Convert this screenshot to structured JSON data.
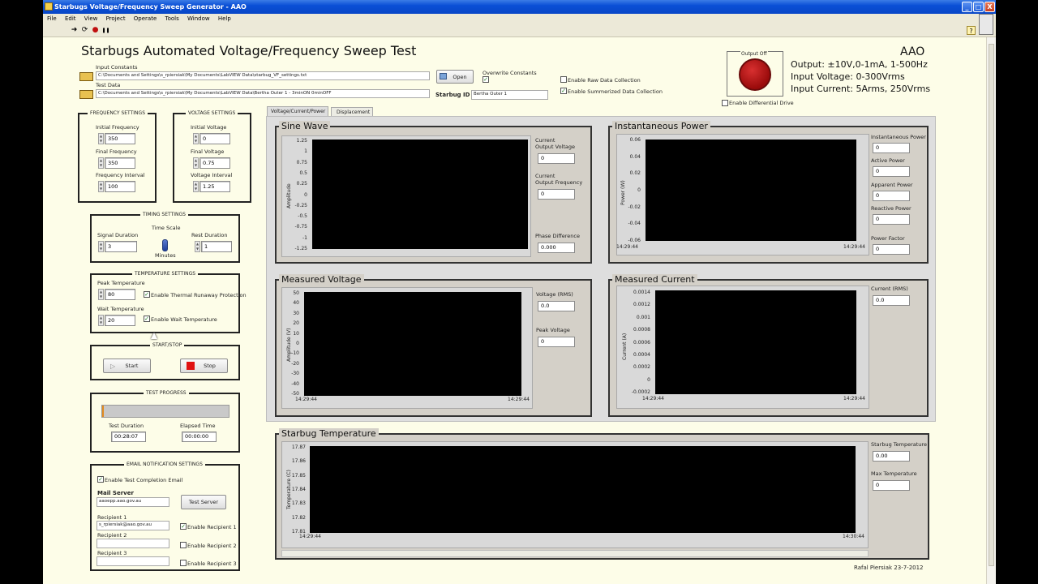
{
  "window": {
    "title": "Starbugs Voltage/Frequency Sweep Generator - AAO",
    "minimize": "_",
    "maximize": "□",
    "close": "X"
  },
  "menu": [
    "File",
    "Edit",
    "View",
    "Project",
    "Operate",
    "Tools",
    "Window",
    "Help"
  ],
  "toolbar": {
    "run": "➜",
    "run_continuous": "⟳",
    "abort": "●",
    "pause": "❚❚",
    "help": "?"
  },
  "header": {
    "title": "Starbugs Automated Voltage/Frequency Sweep Test",
    "org": "AAO",
    "spec1": "Output: ±10V,0-1mA, 1-500Hz",
    "spec2": "Input Voltage: 0-300Vrms",
    "spec3": "Input Current: 5Arms, 250Vrms"
  },
  "files": {
    "input_constants_label": "Input Constants",
    "input_constants_path": "C:\\Documents and Settings\\s_rpiersiak\\My Documents\\LabVIEW Data\\starbug_VF_settings.txt",
    "test_data_label": "Test Data",
    "test_data_path": "C:\\Documents and Settings\\s_rpiersiak\\My Documents\\LabVIEW Data\\Bertha Outer 1 - 3minON 0minOFF",
    "open_label": "Open",
    "overwrite_label": "Overwrite Constants",
    "starbug_id_label": "Starbug ID",
    "starbug_id_value": "Bertha Outer 1",
    "raw_data_label": "Enable Raw Data Collection",
    "summ_data_label": "Enable Summerized Data Collection"
  },
  "output": {
    "label": "Output Off",
    "diff_drive_label": "Enable Differential Drive"
  },
  "frequency": {
    "title": "FREQUENCY SETTINGS",
    "initial_label": "Initial Frequency",
    "initial": "350",
    "final_label": "Final Frequency",
    "final": "350",
    "interval_label": "Frequency Interval",
    "interval": "100"
  },
  "voltage": {
    "title": "VOLTAGE SETTINGS",
    "initial_label": "Initial Voltage",
    "initial": "0",
    "final_label": "Final Voltage",
    "final": "0.75",
    "interval_label": "Voltage Interval",
    "interval": "1.25"
  },
  "timing": {
    "title": "TIMING SETTINGS",
    "signal_label": "Signal Duration",
    "signal": "3",
    "scale_label": "Time Scale",
    "scale_value": "Minutes",
    "rest_label": "Rest Duration",
    "rest": "1"
  },
  "temperature": {
    "title": "TEMPERATURE SETTINGS",
    "peak_label": "Peak Temperature",
    "peak": "80",
    "runaway_label": "Enable Thermal Runaway Protection",
    "wait_label": "Wait Temperature",
    "wait": "20",
    "enable_wait_label": "Enable Wait Temperature"
  },
  "startstop": {
    "title": "START/STOP",
    "start": "Start",
    "stop": "Stop"
  },
  "progress": {
    "title": "TEST PROGRESS",
    "fraction": 0.01,
    "duration_label": "Test Duration",
    "duration": "00:28:07",
    "elapsed_label": "Elapsed Time",
    "elapsed": "00:00:00"
  },
  "email": {
    "title": "EMAIL NOTIFICATION SETTINGS",
    "enable_label": "Enable Test Completion Email",
    "server_label": "Mail Server",
    "server": "aaoepp.aao.gov.au",
    "test_server": "Test Server",
    "r1_label": "Recipient 1",
    "r1": "s_rpiersiak@aao.gov.au",
    "r1_enable": "Enable Recipient 1",
    "r2_label": "Recipient 2",
    "r2": "",
    "r2_enable": "Enable Recipient 2",
    "r3_label": "Recipient 3",
    "r3": "",
    "r3_enable": "Enable Recipient 3"
  },
  "tabs": [
    "Voltage/Current/Power",
    "Displacement"
  ],
  "sine": {
    "title": "Sine Wave",
    "ylabel": "Amplitude",
    "yticks": [
      "1.25",
      "1",
      "0.75",
      "0.5",
      "0.25",
      "0",
      "-0.25",
      "-0.5",
      "-0.75",
      "-1",
      "-1.25"
    ],
    "ind1_label1": "Current",
    "ind1_label2": "Output Voltage",
    "ind1": "0",
    "ind2_label1": "Current",
    "ind2_label2": "Output Frequency",
    "ind2": "0",
    "ind3_label": "Phase Difference",
    "ind3": "0.000"
  },
  "power": {
    "title": "Instantaneous Power",
    "ylabel": "Power (W)",
    "yticks": [
      "0.06",
      "0.04",
      "0.02",
      "0",
      "-0.02",
      "-0.04",
      "-0.06"
    ],
    "x0": "14:29:44",
    "x1": "14:29:44",
    "inst_label": "Instantaneous Power",
    "inst": "0",
    "active_label": "Active Power",
    "active": "0",
    "apparent_label": "Apparent Power",
    "apparent": "0",
    "reactive_label": "Reactive Power",
    "reactive": "0",
    "pf_label": "Power Factor",
    "pf": "0"
  },
  "mvolt": {
    "title": "Measured Voltage",
    "ylabel": "Amplitude (V)",
    "yticks": [
      "50",
      "40",
      "30",
      "20",
      "10",
      "0",
      "-10",
      "-20",
      "-30",
      "-40",
      "-50"
    ],
    "x0": "14:29:44",
    "x1": "14:29:44",
    "rms_label": "Voltage (RMS)",
    "rms": "0.0",
    "peak_label": "Peak Voltage",
    "peak": "0"
  },
  "mcurr": {
    "title": "Measured Current",
    "ylabel": "Current (A)",
    "yticks": [
      "0.0014",
      "0.0012",
      "0.001",
      "0.0008",
      "0.0006",
      "0.0004",
      "0.0002",
      "0",
      "-0.0002"
    ],
    "x0": "14:29:44",
    "x1": "14:29:44",
    "rms_label": "Current (RMS)",
    "rms": "0.0"
  },
  "temp": {
    "title": "Starbug Temperature",
    "ylabel": "Temperature (C)",
    "yticks": [
      "17.87",
      "17.86",
      "17.85",
      "17.84",
      "17.83",
      "17.82",
      "17.81"
    ],
    "x0": "14:29:44",
    "x1": "14:30:44",
    "st_label": "Starbug Temperature",
    "st": "0.00",
    "max_label": "Max Temperature",
    "max": "0"
  },
  "footer": "Rafal Piersiak 23-7-2012",
  "colors": {
    "titlebar": "#0a4fd6",
    "panel_bg": "#fdfde8",
    "led": "#b40f0f",
    "stop": "#e01010",
    "plot_bg": "#000000"
  }
}
